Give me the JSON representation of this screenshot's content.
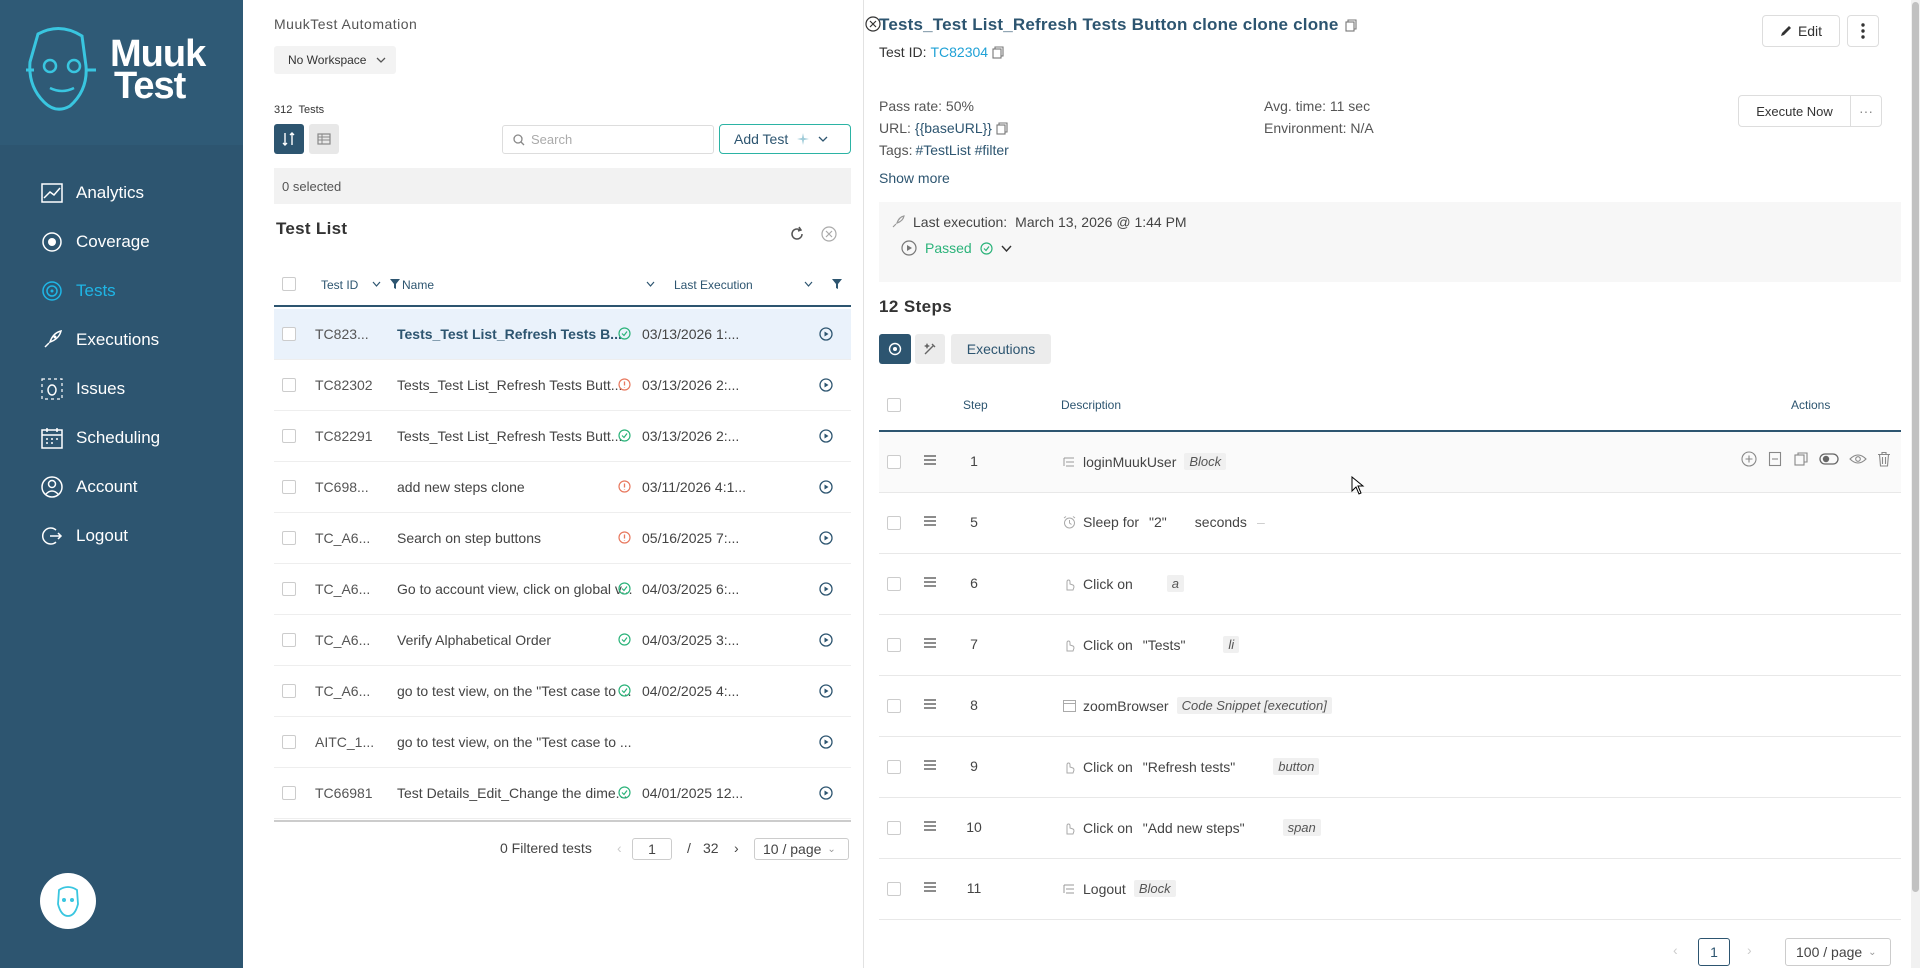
{
  "brand": {
    "line1": "Muuk",
    "line2": "Test"
  },
  "nav": [
    {
      "label": "Analytics",
      "icon": "chart-icon",
      "active": false
    },
    {
      "label": "Coverage",
      "icon": "coverage-icon",
      "active": false
    },
    {
      "label": "Tests",
      "icon": "tests-icon",
      "active": true
    },
    {
      "label": "Executions",
      "icon": "rocket-icon",
      "active": false
    },
    {
      "label": "Issues",
      "icon": "bug-icon",
      "active": false
    },
    {
      "label": "Scheduling",
      "icon": "calendar-icon",
      "active": false
    },
    {
      "label": "Account",
      "icon": "user-icon",
      "active": false
    },
    {
      "label": "Logout",
      "icon": "logout-icon",
      "active": false
    }
  ],
  "tests_panel": {
    "app_title": "MuukTest Automation",
    "workspace": "No Workspace",
    "count_number": "312",
    "count_label": "Tests",
    "search_placeholder": "Search",
    "add_test_label": "Add Test",
    "selected_text": "0 selected",
    "list_title": "Test List",
    "columns": {
      "id": "Test ID",
      "name": "Name",
      "last_execution": "Last Execution"
    },
    "rows": [
      {
        "id": "TC823...",
        "name": "Tests_Test List_Refresh Tests B...",
        "status": "passed",
        "date": "03/13/2026 1:...",
        "selected": true
      },
      {
        "id": "TC82302",
        "name": "Tests_Test List_Refresh Tests Butt...",
        "status": "failed",
        "date": "03/13/2026 2:...",
        "selected": false
      },
      {
        "id": "TC82291",
        "name": "Tests_Test List_Refresh Tests Butt...",
        "status": "passed",
        "date": "03/13/2026 2:...",
        "selected": false
      },
      {
        "id": "TC698...",
        "name": "add new steps clone",
        "status": "failed",
        "date": "03/11/2026 4:1...",
        "selected": false
      },
      {
        "id": "TC_A6...",
        "name": "Search on step buttons",
        "status": "failed",
        "date": "05/16/2025 7:...",
        "selected": false
      },
      {
        "id": "TC_A6...",
        "name": "Go to account view, click on global v...",
        "status": "passed",
        "date": "04/03/2025 6:...",
        "selected": false
      },
      {
        "id": "TC_A6...",
        "name": "Verify Alphabetical Order",
        "status": "passed",
        "date": "04/03/2025 3:...",
        "selected": false
      },
      {
        "id": "TC_A6...",
        "name": "go to test view, on the \"Test case to ...",
        "status": "passed",
        "date": "04/02/2025 4:...",
        "selected": false
      },
      {
        "id": "AITC_1...",
        "name": "go to test view, on the \"Test case to ...",
        "status": "",
        "date": "",
        "selected": false
      },
      {
        "id": "TC66981",
        "name": "Test Details_Edit_Change the dime...",
        "status": "passed",
        "date": "04/01/2025 12...",
        "selected": false
      }
    ],
    "pager": {
      "filtered": "0 Filtered tests",
      "page": "1",
      "separator": "/",
      "total_pages": "32",
      "per_page": "10 / page"
    }
  },
  "detail": {
    "title": "Tests_Test List_Refresh Tests Button clone clone clone",
    "test_id_label": "Test ID:",
    "test_id": "TC82304",
    "edit_label": "Edit",
    "pass_rate": "Pass rate: 50%",
    "url_label": "URL:",
    "url_value": "{{baseURL}}",
    "tags_label": "Tags:",
    "tags_value": "#TestList #filter",
    "avg_time": "Avg. time: 11 sec",
    "environment": "Environment: N/A",
    "execute_now": "Execute Now",
    "show_more": "Show more",
    "last_execution_label": "Last execution:",
    "last_execution_value": "March 13, 2026 @ 1:44 PM",
    "last_execution_status": "Passed",
    "steps_title": "12 Steps",
    "executions_tab": "Executions",
    "columns": {
      "step": "Step",
      "description": "Description",
      "actions": "Actions"
    },
    "steps": [
      {
        "num": "1",
        "icon": "list-icon",
        "action": "loginMuukUser",
        "target": "",
        "suffix": "",
        "tag": "Block"
      },
      {
        "num": "5",
        "icon": "alarm-icon",
        "action": "Sleep for",
        "target": "\"2\"",
        "suffix": "seconds",
        "tag": ""
      },
      {
        "num": "6",
        "icon": "click-icon",
        "action": "Click on",
        "target": "",
        "suffix": "",
        "tag": "a"
      },
      {
        "num": "7",
        "icon": "click-icon",
        "action": "Click on",
        "target": "\"Tests\"",
        "suffix": "",
        "tag": "li"
      },
      {
        "num": "8",
        "icon": "code-icon",
        "action": "zoomBrowser",
        "target": "",
        "suffix": "",
        "tag": "Code Snippet [execution]"
      },
      {
        "num": "9",
        "icon": "click-icon",
        "action": "Click on",
        "target": "\"Refresh tests\"",
        "suffix": "",
        "tag": "button"
      },
      {
        "num": "10",
        "icon": "click-icon",
        "action": "Click on",
        "target": "\"Add new steps\"",
        "suffix": "",
        "tag": "span"
      },
      {
        "num": "11",
        "icon": "list-icon",
        "action": "Logout",
        "target": "",
        "suffix": "",
        "tag": "Block"
      }
    ],
    "pager": {
      "page": "1",
      "per_page": "100 / page"
    }
  },
  "colors": {
    "sidebar": "#2d5570",
    "accent": "#1fb6e6",
    "passed": "#2bb37a",
    "failed": "#e8785e"
  }
}
